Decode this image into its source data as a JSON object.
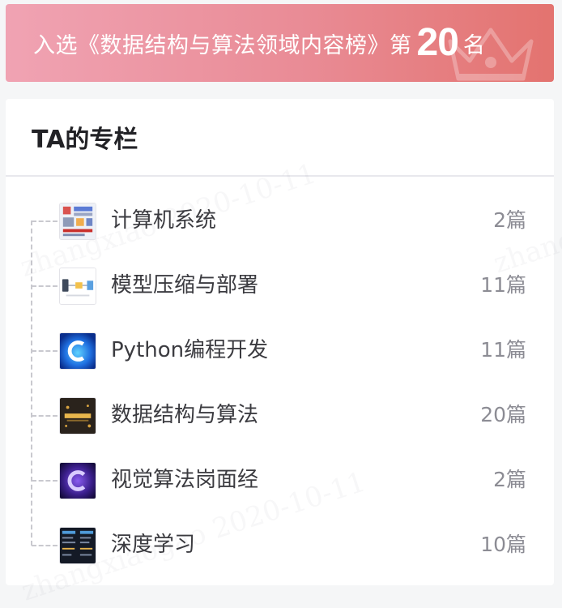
{
  "rank_banner": {
    "prefix": "入选《数据结构与算法领域内容榜》第",
    "rank": "20",
    "suffix": "名"
  },
  "columns_section": {
    "title": "TA的专栏",
    "items": [
      {
        "name": "计算机系统",
        "count": "2篇",
        "thumb": "computer-system-thumb"
      },
      {
        "name": "模型压缩与部署",
        "count": "11篇",
        "thumb": "model-compression-thumb"
      },
      {
        "name": "Python编程开发",
        "count": "11篇",
        "thumb": "python-dev-thumb"
      },
      {
        "name": "数据结构与算法",
        "count": "20篇",
        "thumb": "algorithms-thumb"
      },
      {
        "name": "视觉算法岗面经",
        "count": "2篇",
        "thumb": "vision-interview-thumb"
      },
      {
        "name": "深度学习",
        "count": "10篇",
        "thumb": "deep-learning-thumb"
      }
    ]
  },
  "colors": {
    "banner_start": "#f0a3b3",
    "banner_end": "#e3736f",
    "title_text": "#222226",
    "item_text": "#3b3b40",
    "count_text": "#8c8c94"
  }
}
